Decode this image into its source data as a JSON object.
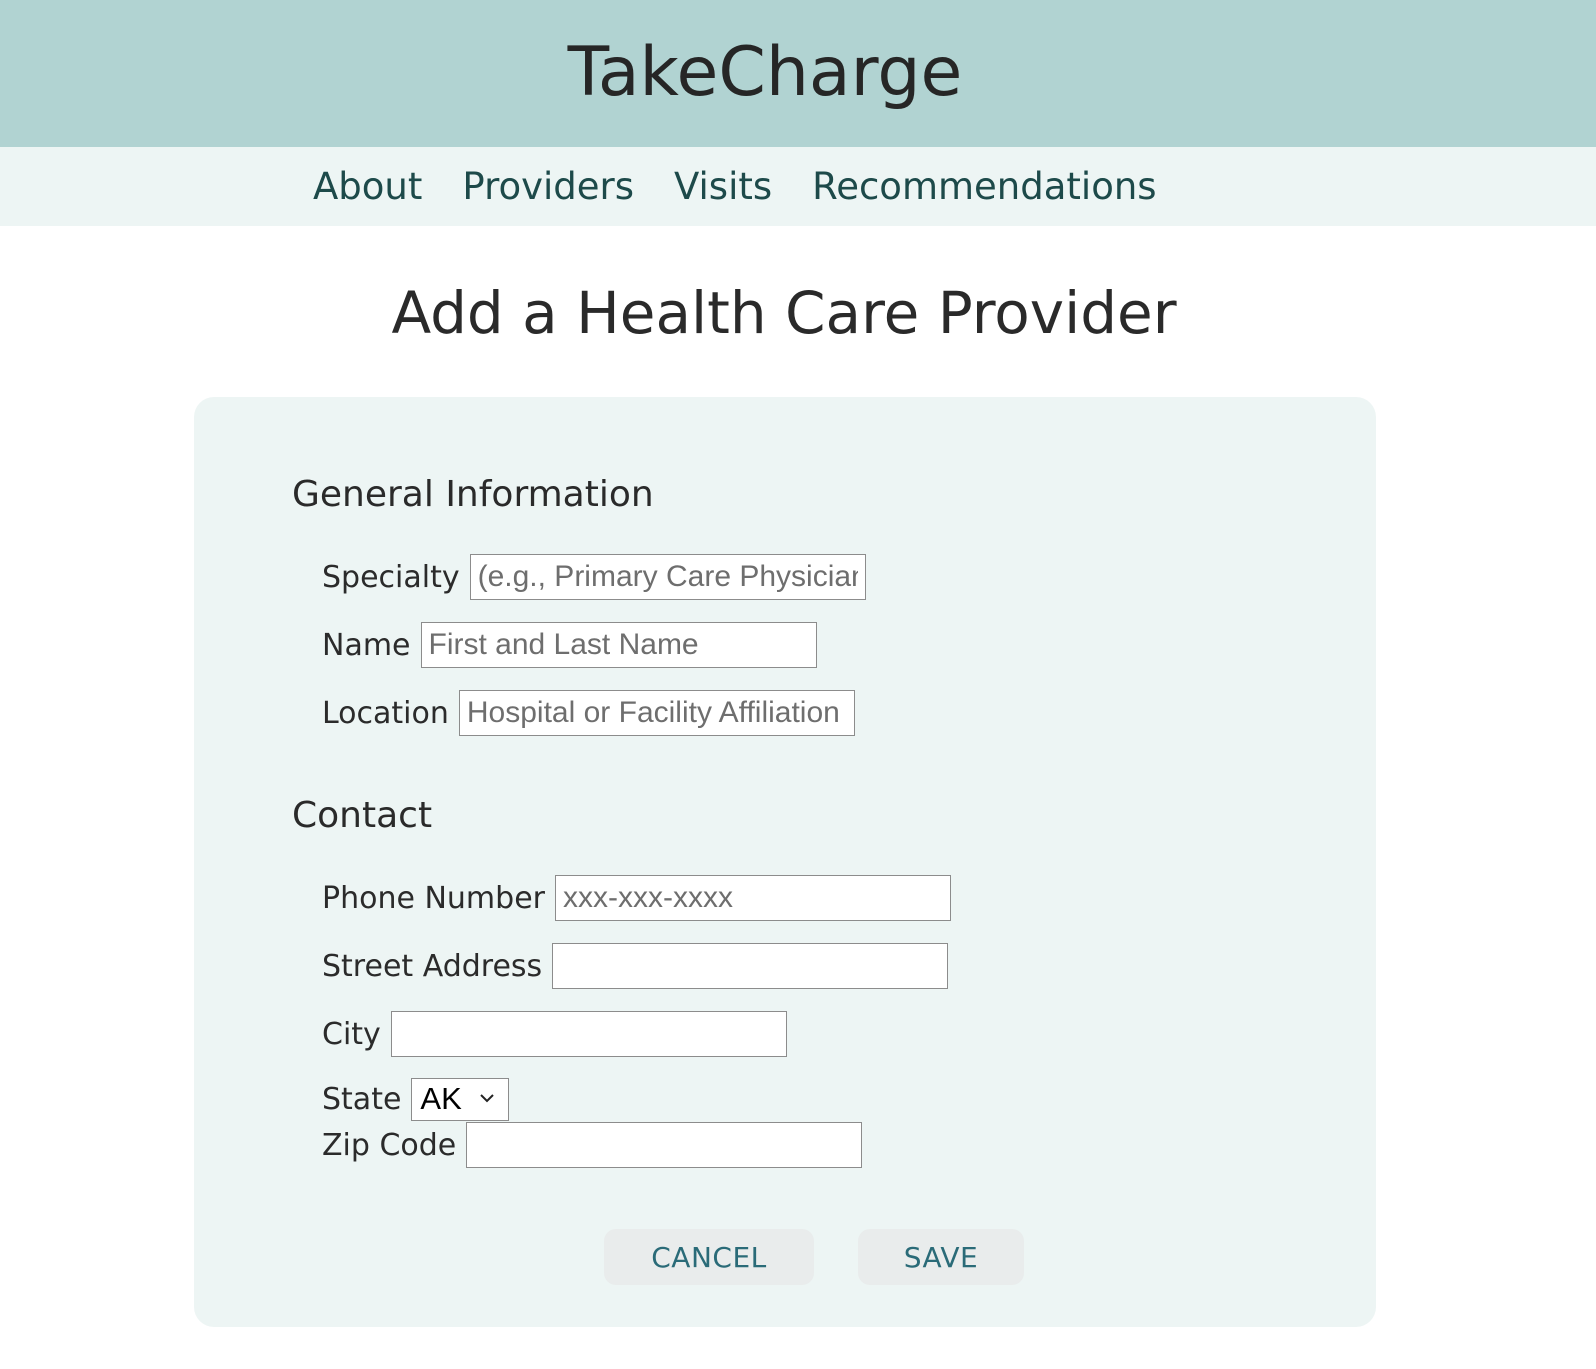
{
  "app": {
    "title": "TakeCharge"
  },
  "nav": {
    "items": [
      {
        "label": "About"
      },
      {
        "label": "Providers"
      },
      {
        "label": "Visits"
      },
      {
        "label": "Recommendations"
      }
    ]
  },
  "page": {
    "title": "Add a Health Care Provider"
  },
  "form": {
    "general": {
      "heading": "General Information",
      "specialty": {
        "label": "Specialty",
        "placeholder": "(e.g., Primary Care Physician)",
        "value": ""
      },
      "name": {
        "label": "Name",
        "placeholder": "First and Last Name",
        "value": ""
      },
      "location": {
        "label": "Location",
        "placeholder": "Hospital or Facility Affiliation",
        "value": ""
      }
    },
    "contact": {
      "heading": "Contact",
      "phone": {
        "label": "Phone Number",
        "placeholder": "xxx-xxx-xxxx",
        "value": ""
      },
      "street": {
        "label": "Street Address",
        "placeholder": "",
        "value": ""
      },
      "city": {
        "label": "City",
        "placeholder": "",
        "value": ""
      },
      "state": {
        "label": "State",
        "selected": "AK"
      },
      "zip": {
        "label": "Zip Code",
        "placeholder": "",
        "value": ""
      }
    },
    "buttons": {
      "cancel": "CANCEL",
      "save": "SAVE"
    }
  },
  "icons": {
    "select_arrow": "chevron-down-icon"
  },
  "colors": {
    "header_bg": "#b1d3d2",
    "nav_bg": "#edf5f4",
    "card_bg": "#edf5f4",
    "nav_text": "#1d4a4a",
    "button_text": "#2a6b78",
    "button_bg": "#e9ecec"
  }
}
